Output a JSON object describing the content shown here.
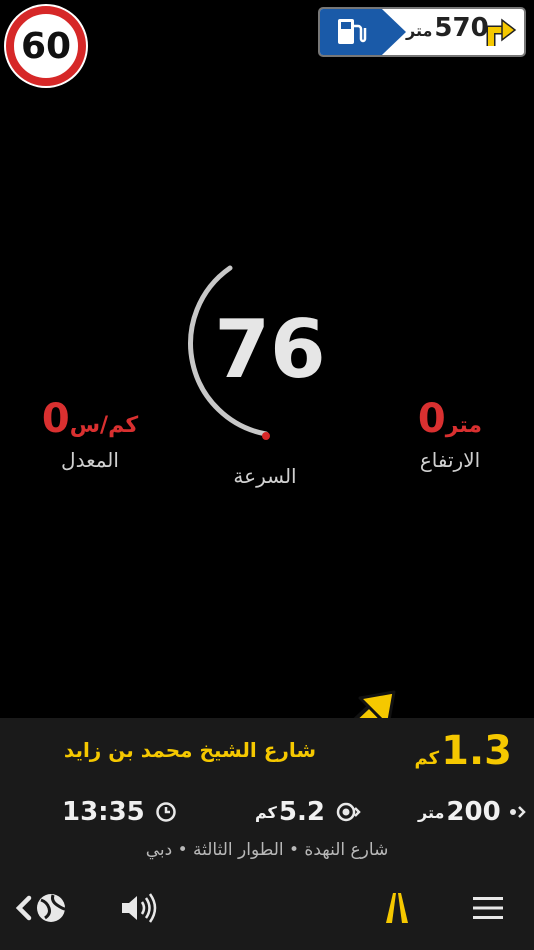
{
  "speed_limit": {
    "value": "60"
  },
  "poi_sign": {
    "distance_value": "570",
    "distance_unit": "متر",
    "icon": "fuel-pump-icon",
    "turn_icon": "turn-right-icon"
  },
  "speed": {
    "value": "76",
    "label": "السرعة"
  },
  "average_speed": {
    "value": "0",
    "unit": "كم/س",
    "label": "المعدل"
  },
  "altitude": {
    "value": "0",
    "unit": "متر",
    "label": "الارتفاع"
  },
  "next_turn": {
    "icon": "turn-right-arrow-icon",
    "distance_value": "1.3",
    "distance_unit": "كم",
    "street": "شارع الشيخ محمد بن زايد"
  },
  "info_row": {
    "arrival_time": "13:35",
    "route_distance_value": "5.2",
    "route_distance_unit": "كم",
    "step_distance_value": "200",
    "step_distance_unit": "متر"
  },
  "address": "شارع النهدة • الطوار الثالثة • دبي",
  "colors": {
    "accent_yellow": "#f5c800",
    "alert_red": "#d93030",
    "panel_bg": "#1a1a1a"
  }
}
